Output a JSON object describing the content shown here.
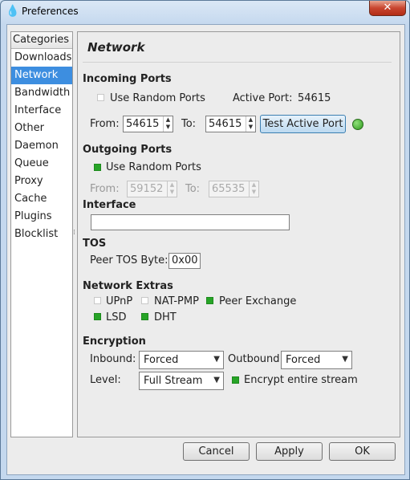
{
  "window": {
    "title": "Preferences",
    "close_glyph": "✕",
    "app_icon": "deluge-drop-icon"
  },
  "categories": {
    "header": "Categories",
    "items": [
      "Downloads",
      "Network",
      "Bandwidth",
      "Interface",
      "Other",
      "Daemon",
      "Queue",
      "Proxy",
      "Cache",
      "Plugins",
      "Blocklist"
    ],
    "selected": "Network"
  },
  "network": {
    "title": "Network",
    "incoming": {
      "heading": "Incoming Ports",
      "use_random_label": "Use Random Ports",
      "use_random_checked": false,
      "active_port_label": "Active Port:",
      "active_port_value": "54615",
      "from_label": "From:",
      "from_value": "54615",
      "to_label": "To:",
      "to_value": "54615",
      "test_button": "Test Active Port",
      "status_color": "#2e9a1c"
    },
    "outgoing": {
      "heading": "Outgoing Ports",
      "use_random_label": "Use Random Ports",
      "use_random_checked": true,
      "from_label": "From:",
      "from_value": "59152",
      "to_label": "To:",
      "to_value": "65535"
    },
    "interface": {
      "heading": "Interface",
      "value": ""
    },
    "tos": {
      "heading": "TOS",
      "label": "Peer TOS Byte:",
      "value": "0x00"
    },
    "extras": {
      "heading": "Network Extras",
      "upnp": {
        "label": "UPnP",
        "checked": false
      },
      "natpmp": {
        "label": "NAT-PMP",
        "checked": false
      },
      "pex": {
        "label": "Peer Exchange",
        "checked": true
      },
      "lsd": {
        "label": "LSD",
        "checked": true
      },
      "dht": {
        "label": "DHT",
        "checked": true
      }
    },
    "encryption": {
      "heading": "Encryption",
      "inbound_label": "Inbound:",
      "inbound_value": "Forced",
      "outbound_label": "Outbound:",
      "outbound_value": "Forced",
      "level_label": "Level:",
      "level_value": "Full Stream",
      "encrypt_entire_label": "Encrypt entire stream",
      "encrypt_entire_checked": true
    }
  },
  "buttons": {
    "cancel": "Cancel",
    "apply": "Apply",
    "ok": "OK"
  },
  "colors": {
    "selection": "#3d8ee0",
    "check_on": "#27a427"
  }
}
